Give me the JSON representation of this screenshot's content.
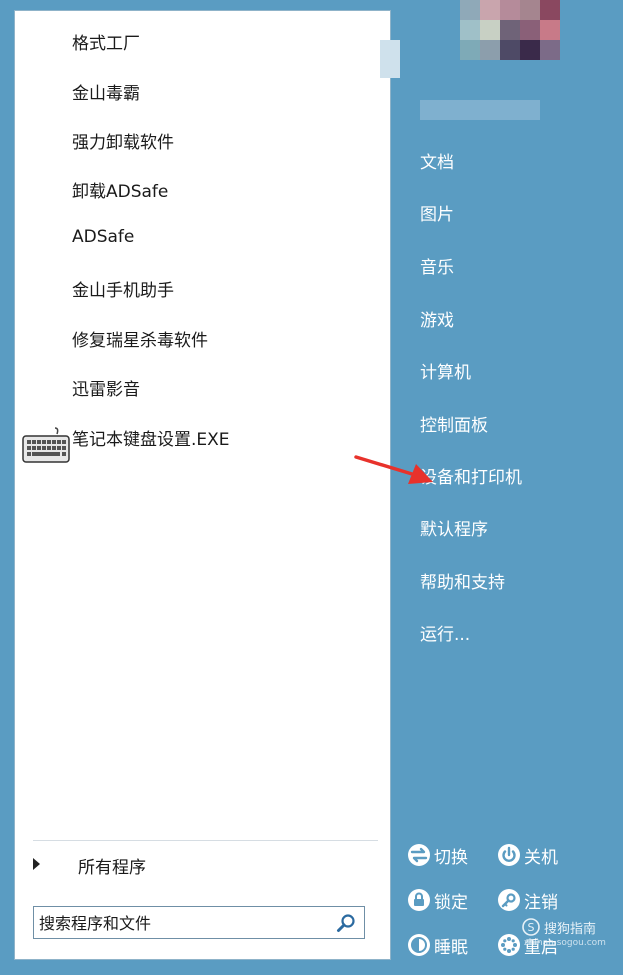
{
  "left_panel": {
    "programs": [
      "格式工厂",
      "金山毒霸",
      "强力卸载软件",
      "卸载ADSafe",
      "ADSafe",
      "金山手机助手",
      "修复瑞星杀毒软件",
      "迅雷影音",
      "笔记本键盘设置.EXE"
    ],
    "all_programs_label": "所有程序",
    "search_placeholder": "搜索程序和文件"
  },
  "right_panel": {
    "items": [
      "文档",
      "图片",
      "音乐",
      "游戏",
      "计算机",
      "控制面板",
      "设备和打印机",
      "默认程序",
      "帮助和支持",
      "运行..."
    ],
    "power": {
      "switch_label": "切换",
      "shutdown_label": "关机",
      "lock_label": "锁定",
      "logoff_label": "注销",
      "sleep_label": "睡眠",
      "restart_label": "重启"
    }
  },
  "watermark": {
    "brand": "搜狗指南",
    "url": "zhinan.sogou.com"
  },
  "icons": {
    "keyboard": "keyboard-icon",
    "search": "search-icon",
    "switch": "switch-user-icon",
    "shutdown": "power-icon",
    "lock": "lock-icon",
    "logoff": "key-icon",
    "sleep": "sleep-icon",
    "restart": "restart-icon"
  },
  "colors": {
    "right_panel_bg": "#5a9cc2",
    "left_panel_bg": "#ffffff",
    "annotation_arrow": "#e8322b"
  }
}
